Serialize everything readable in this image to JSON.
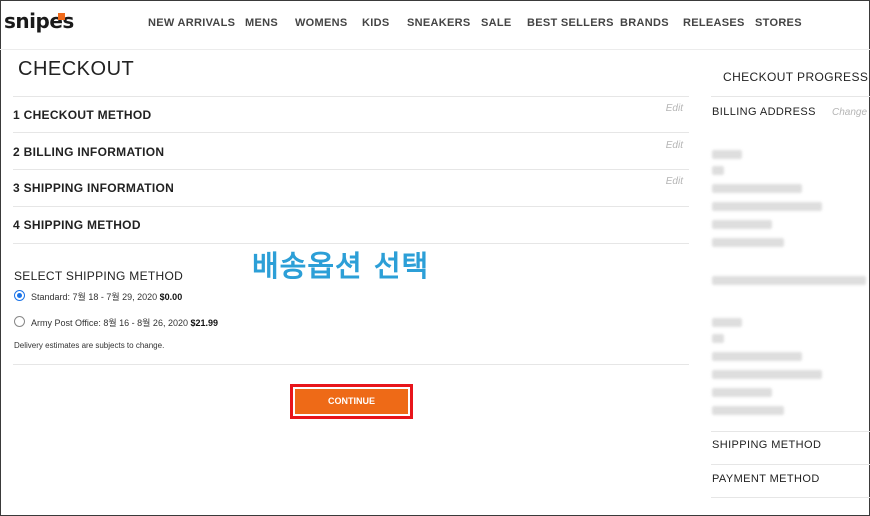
{
  "brand": {
    "name": "snipes",
    "accent": "#f06a1b"
  },
  "nav": [
    "NEW ARRIVALS",
    "MENS",
    "WOMENS",
    "KIDS",
    "SNEAKERS",
    "SALE",
    "BEST SELLERS",
    "BRANDS",
    "RELEASES",
    "STORES"
  ],
  "checkout": {
    "title": "CHECKOUT",
    "steps": [
      {
        "label": "1  CHECKOUT METHOD",
        "edit": "Edit"
      },
      {
        "label": "2  BILLING INFORMATION",
        "edit": "Edit"
      },
      {
        "label": "3  SHIPPING INFORMATION",
        "edit": "Edit"
      },
      {
        "label": "4  SHIPPING METHOD",
        "edit": ""
      }
    ]
  },
  "shipping": {
    "heading": "SELECT SHIPPING METHOD",
    "options": [
      {
        "label": "Standard: 7월 18 - 7월 29, 2020",
        "price": "$0.00",
        "selected": true
      },
      {
        "label": "Army Post Office: 8월 16 - 8월 26, 2020",
        "price": "$21.99",
        "selected": false
      }
    ],
    "note": "Delivery estimates are subjects to change.",
    "overlay_text": "배송옵션 선택"
  },
  "continue_label": "CONTINUE",
  "colors": {
    "button": "#ee6a17",
    "highlight_border": "#e8151b",
    "overlay": "#2c9fd7",
    "radio": "#1a73e8"
  },
  "sidebar": {
    "title": "CHECKOUT PROGRESS",
    "billing_label": "BILLING ADDRESS",
    "billing_edit": "Change",
    "shipping_method_label": "SHIPPING METHOD",
    "payment_method_label": "PAYMENT METHOD"
  }
}
